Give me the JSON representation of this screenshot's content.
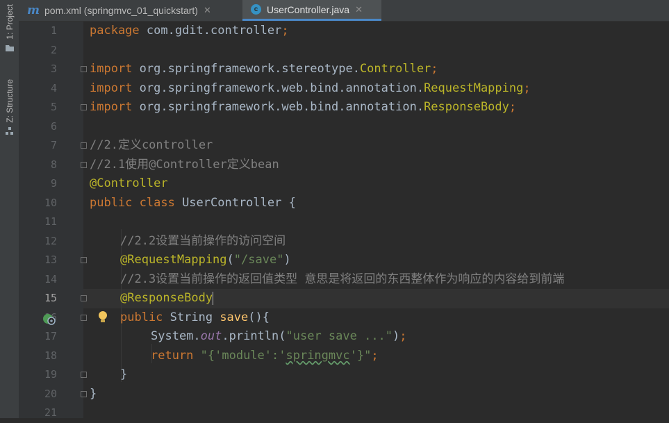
{
  "sidebar": {
    "project_label": "1: Project",
    "structure_label": "Z: Structure"
  },
  "tabs": [
    {
      "label": "pom.xml (springmvc_01_quickstart)",
      "icon": "maven-m-icon",
      "active": false
    },
    {
      "label": "UserController.java",
      "icon": "java-class-icon",
      "active": true
    }
  ],
  "editor": {
    "current_line": 15,
    "line_numbers": [
      "1",
      "2",
      "3",
      "4",
      "5",
      "6",
      "7",
      "8",
      "9",
      "10",
      "11",
      "12",
      "13",
      "14",
      "15",
      "16",
      "17",
      "18",
      "19",
      "20",
      "21"
    ],
    "code": {
      "l1_kw": "package",
      "l1_rest": " com.gdit.controller",
      "l1_semi": ";",
      "l3_kw": "import",
      "l3_pkg": " org.springframework.stereotype.",
      "l3_cls": "Controller",
      "l3_semi": ";",
      "l4_kw": "import",
      "l4_pkg": " org.springframework.web.bind.annotation.",
      "l4_cls": "RequestMapping",
      "l4_semi": ";",
      "l5_kw": "import",
      "l5_pkg": " org.springframework.web.bind.annotation.",
      "l5_cls": "ResponseBody",
      "l5_semi": ";",
      "l7": "//2.定义controller",
      "l8": "//2.1使用@Controller定义bean",
      "l9": "@Controller",
      "l10_kw": "public class",
      "l10_rest": " UserController {",
      "l12": "//2.2设置当前操作的访问空间",
      "l13_an": "@RequestMapping",
      "l13_p1": "(",
      "l13_str": "\"/save\"",
      "l13_p2": ")",
      "l14": "//2.3设置当前操作的返回值类型 意思是将返回的东西整体作为响应的内容给到前端",
      "l15": "@ResponseBody",
      "l16_kw": "public",
      "l16_type": " String ",
      "l16_fn": "save",
      "l16_rest": "(){",
      "l17_a": "System.",
      "l17_out": "out",
      "l17_b": ".println(",
      "l17_str": "\"user save ...\"",
      "l17_c": ")",
      "l17_semi": ";",
      "l18_kw": "return",
      "l18_s1": " \"{'module':'",
      "l18_s2": "springmvc",
      "l18_s3": "'}\"",
      "l18_semi": ";",
      "l19": "}",
      "l20": "}"
    }
  }
}
